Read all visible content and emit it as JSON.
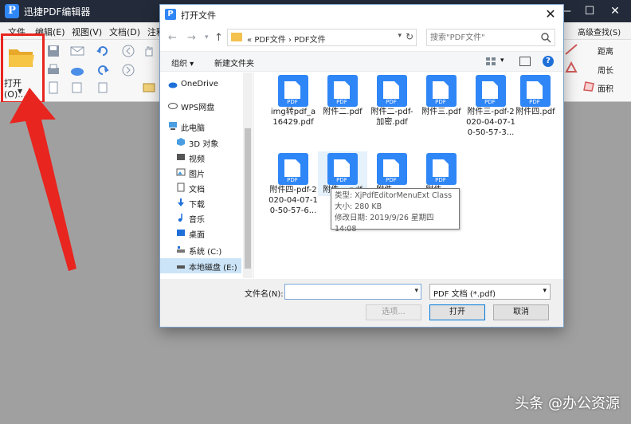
{
  "app": {
    "title": "迅捷PDF编辑器",
    "logo": "P",
    "menu": [
      "文件",
      "编辑(E)",
      "视图(V)",
      "文档(D)",
      "注释"
    ],
    "open_label": "打开(O)...",
    "right_tools": [
      "高级查找(S)",
      "距离",
      "周长",
      "面积"
    ]
  },
  "dialog": {
    "title": "打开文件",
    "address": [
      "«",
      "PDF文件",
      "›",
      "PDF文件"
    ],
    "search_placeholder": "搜索\"PDF文件\"",
    "organize_label": "组织 ▾",
    "new_folder_label": "新建文件夹",
    "nav_items": [
      {
        "label": "OneDrive",
        "icon": "cloud-icon"
      },
      {
        "label": "WPS网盘",
        "icon": "cloud-icon"
      },
      {
        "label": "此电脑",
        "icon": "computer-icon"
      },
      {
        "label": "3D 对象",
        "icon": "cube-icon"
      },
      {
        "label": "视频",
        "icon": "video-icon"
      },
      {
        "label": "图片",
        "icon": "picture-icon"
      },
      {
        "label": "文档",
        "icon": "document-icon"
      },
      {
        "label": "下载",
        "icon": "download-icon"
      },
      {
        "label": "音乐",
        "icon": "music-icon"
      },
      {
        "label": "桌面",
        "icon": "desktop-icon"
      },
      {
        "label": "系统 (C:)",
        "icon": "drive-icon"
      },
      {
        "label": "本地磁盘 (E:)",
        "icon": "drive-icon"
      }
    ],
    "files": [
      {
        "name": "img转pdf_a16429.pdf"
      },
      {
        "name": "附件二.pdf"
      },
      {
        "name": "附件二-pdf-加密.pdf"
      },
      {
        "name": "附件三.pdf"
      },
      {
        "name": "附件三-pdf-2020-04-07-10-50-57-3..."
      },
      {
        "name": "附件四.pdf"
      },
      {
        "name": "附件四-pdf-2020-04-07-10-50-57-6..."
      },
      {
        "name": "附件一.pdf"
      },
      {
        "name": "附件一..."
      },
      {
        "name": "附件一..."
      }
    ],
    "pdf_icon_text": "PDF",
    "tooltip": {
      "type": "类型: XjPdfEditorMenuExt Class",
      "size": "大小: 280 KB",
      "modified": "修改日期: 2019/9/26 星期四 14:08"
    },
    "filename_label": "文件名(N):",
    "filename_value": "",
    "filetype": "PDF 文档 (*.pdf)",
    "preview_label": "选项...",
    "open_label": "打开",
    "cancel_label": "取消"
  },
  "watermark": "头条 @办公资源",
  "colors": {
    "highlight_red": "#e8251f",
    "pdf_blue": "#2f86f6",
    "titlebar_dark": "#232b3a"
  }
}
